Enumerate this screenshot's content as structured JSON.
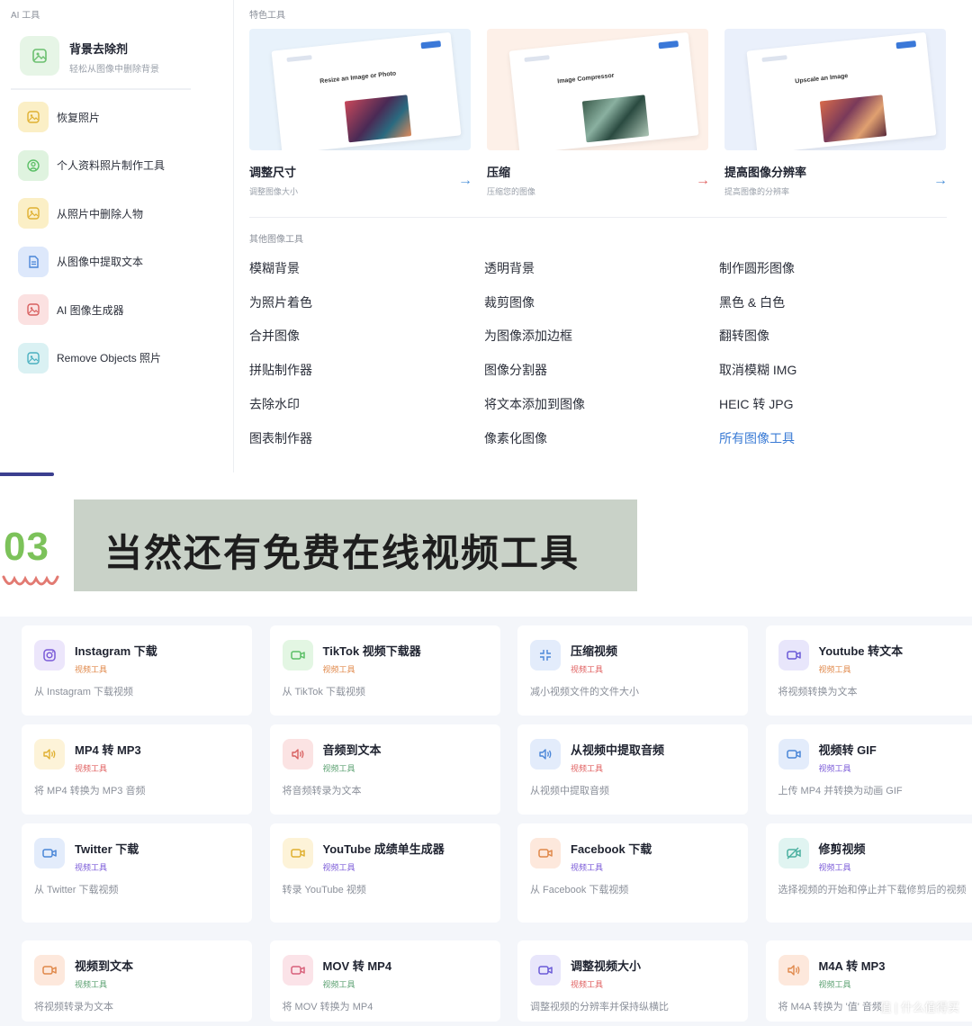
{
  "top": {
    "ai_tools_label": "AI 工具",
    "featured_ai": {
      "title": "背景去除剂",
      "subtitle": "轻松从图像中删除背景",
      "icon": "image-icon"
    },
    "ai_tools": [
      {
        "label": "恢复照片",
        "icon": "image-restore-icon",
        "color": "#fbefc6"
      },
      {
        "label": "个人资料照片制作工具",
        "icon": "profile-icon",
        "color": "#dff3df"
      },
      {
        "label": "从照片中删除人物",
        "icon": "person-remove-icon",
        "color": "#fbefc6"
      },
      {
        "label": "从图像中提取文本",
        "icon": "document-icon",
        "color": "#dde8fb"
      },
      {
        "label": "AI 图像生成器",
        "icon": "ai-image-icon",
        "color": "#fbe1e1"
      },
      {
        "label": "Remove Objects 照片",
        "icon": "object-remove-icon",
        "color": "#daf1f3"
      }
    ],
    "featured_label": "特色工具",
    "featured_tools": [
      {
        "title": "调整尺寸",
        "subtitle": "调整图像大小",
        "thumb_text": "Resize an Image or Photo",
        "arrow_color": "#4a8fd8",
        "bg": "#e8f2fb"
      },
      {
        "title": "压缩",
        "subtitle": "压缩您的图像",
        "thumb_text": "Image Compressor",
        "arrow_color": "#e06060",
        "bg": "#fdf0e8"
      },
      {
        "title": "提高图像分辨率",
        "subtitle": "提高图像的分辨率",
        "thumb_text": "Upscale an Image",
        "arrow_color": "#4a8fd8",
        "bg": "#eaf0fb"
      }
    ],
    "other_label": "其他图像工具",
    "other_tools": [
      [
        "模糊背景",
        "透明背景",
        "制作圆形图像"
      ],
      [
        "为照片着色",
        "裁剪图像",
        "黑色 & 白色"
      ],
      [
        "合并图像",
        "为图像添加边框",
        "翻转图像"
      ],
      [
        "拼贴制作器",
        "图像分割器",
        "取消模糊 IMG"
      ],
      [
        "去除水印",
        "将文本添加到图像",
        "HEIC 转 JPG"
      ],
      [
        "图表制作器",
        "像素化图像",
        "所有图像工具"
      ]
    ],
    "link_color": "#3a7bd5"
  },
  "banner": {
    "number": "03",
    "headline": "当然还有免费在线视频工具"
  },
  "video_tools": [
    [
      {
        "title": "Instagram 下载",
        "category": "视频工具",
        "desc": "从 Instagram 下载视频",
        "icon": "instagram-icon",
        "bg": "#ece6fb",
        "fg": "#7a5ad8",
        "cat_color": "#e0884a"
      },
      {
        "title": "TikTok 视频下载器",
        "category": "视频工具",
        "desc": "从 TikTok 下载视频",
        "icon": "video-camera-icon",
        "bg": "#e3f6e3",
        "fg": "#5bbf66",
        "cat_color": "#e0884a"
      },
      {
        "title": "压缩视频",
        "category": "视频工具",
        "desc": "减小视频文件的文件大小",
        "icon": "compress-icon",
        "bg": "#e3ecfb",
        "fg": "#4a86d8",
        "cat_color": "#e06060"
      },
      {
        "title": "Youtube 转文本",
        "category": "视频工具",
        "desc": "将视频转换为文本",
        "icon": "video-camera-icon",
        "bg": "#e8e6fb",
        "fg": "#6a5ad8",
        "cat_color": "#e0884a"
      }
    ],
    [
      {
        "title": "MP4 转 MP3",
        "category": "视频工具",
        "desc": "将 MP4 转换为 MP3 音频",
        "icon": "audio-icon",
        "bg": "#fdf3d8",
        "fg": "#e0b030",
        "cat_color": "#e06060"
      },
      {
        "title": "音频到文本",
        "category": "视频工具",
        "desc": "将音频转录为文本",
        "icon": "audio-icon",
        "bg": "#fbe3e3",
        "fg": "#d86060",
        "cat_color": "#5aa070"
      },
      {
        "title": "从视频中提取音频",
        "category": "视频工具",
        "desc": "从视频中提取音频",
        "icon": "audio-icon",
        "bg": "#e3ecfb",
        "fg": "#4a86d8",
        "cat_color": "#e06060"
      },
      {
        "title": "视频转 GIF",
        "category": "视频工具",
        "desc": "上传 MP4 并转换为动画 GIF",
        "icon": "video-camera-icon",
        "bg": "#e3ecfb",
        "fg": "#4a86d8",
        "cat_color": "#7a5ad8"
      }
    ],
    [
      {
        "title": "Twitter 下载",
        "category": "视频工具",
        "desc": "从 Twitter 下载视频",
        "icon": "video-camera-icon",
        "bg": "#e3ecfb",
        "fg": "#4a86d8",
        "cat_color": "#7a5ad8"
      },
      {
        "title": "YouTube 成绩单生成器",
        "category": "视频工具",
        "desc": "转录 YouTube 视频",
        "icon": "video-camera-icon",
        "bg": "#fdf3d8",
        "fg": "#e0b030",
        "cat_color": "#7a5ad8"
      },
      {
        "title": "Facebook 下载",
        "category": "视频工具",
        "desc": "从 Facebook 下载视频",
        "icon": "video-camera-icon",
        "bg": "#fde8dc",
        "fg": "#e0884a",
        "cat_color": "#7a5ad8"
      },
      {
        "title": "修剪视频",
        "category": "视频工具",
        "desc": "选择视频的开始和停止并下载修剪后的视频",
        "icon": "trim-icon",
        "bg": "#e0f4f1",
        "fg": "#4ab0a0",
        "cat_color": "#7a5ad8"
      }
    ],
    [
      {
        "title": "视频到文本",
        "category": "视频工具",
        "desc": "将视频转录为文本",
        "icon": "video-camera-icon",
        "bg": "#fde8dc",
        "fg": "#e0884a",
        "cat_color": "#5aa070"
      },
      {
        "title": "MOV 转 MP4",
        "category": "视频工具",
        "desc": "将 MOV 转换为 MP4",
        "icon": "video-camera-icon",
        "bg": "#fbe3e8",
        "fg": "#d8607a",
        "cat_color": "#5aa070"
      },
      {
        "title": "调整视频大小",
        "category": "视频工具",
        "desc": "调整视频的分辨率并保持纵横比",
        "icon": "video-camera-icon",
        "bg": "#e8e6fb",
        "fg": "#6a5ad8",
        "cat_color": "#e06060"
      },
      {
        "title": "M4A 转 MP3",
        "category": "视频工具",
        "desc": "将 M4A 转换为 '值' 音频",
        "icon": "audio-icon",
        "bg": "#fde8dc",
        "fg": "#e0884a",
        "cat_color": "#5aa070"
      }
    ]
  ],
  "watermark": "值 | 什么值得买"
}
